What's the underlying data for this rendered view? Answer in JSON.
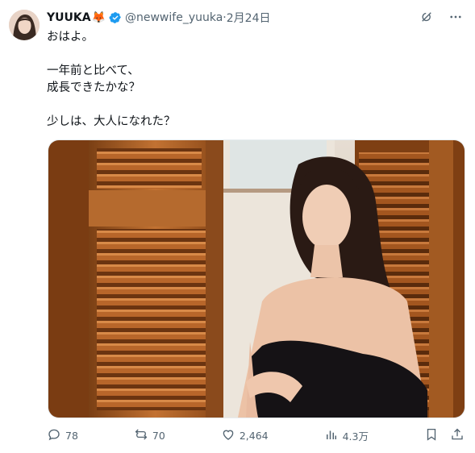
{
  "author": {
    "name": "YUUKA",
    "emoji": "🦊",
    "handle": "@newwife_yuuka",
    "separator": " · ",
    "date": "2月24日"
  },
  "tweet": {
    "text": "おはよ。\n\n一年前と比べて、\n成長できたかな？\n\n少しは、大人になれた？"
  },
  "media": {
    "alt": "photo"
  },
  "actions": {
    "replies": "78",
    "reposts": "70",
    "likes": "2,464",
    "views": "4.3万"
  },
  "icons": {
    "verified": "verified-badge-icon",
    "grok": "grok-icon",
    "more": "more-icon",
    "reply": "reply-icon",
    "repost": "repost-icon",
    "like": "like-icon",
    "views": "views-icon",
    "bookmark": "bookmark-icon",
    "share": "share-icon"
  },
  "colors": {
    "text": "#0f1419",
    "muted": "#536471",
    "verified": "#1d9bf0"
  }
}
